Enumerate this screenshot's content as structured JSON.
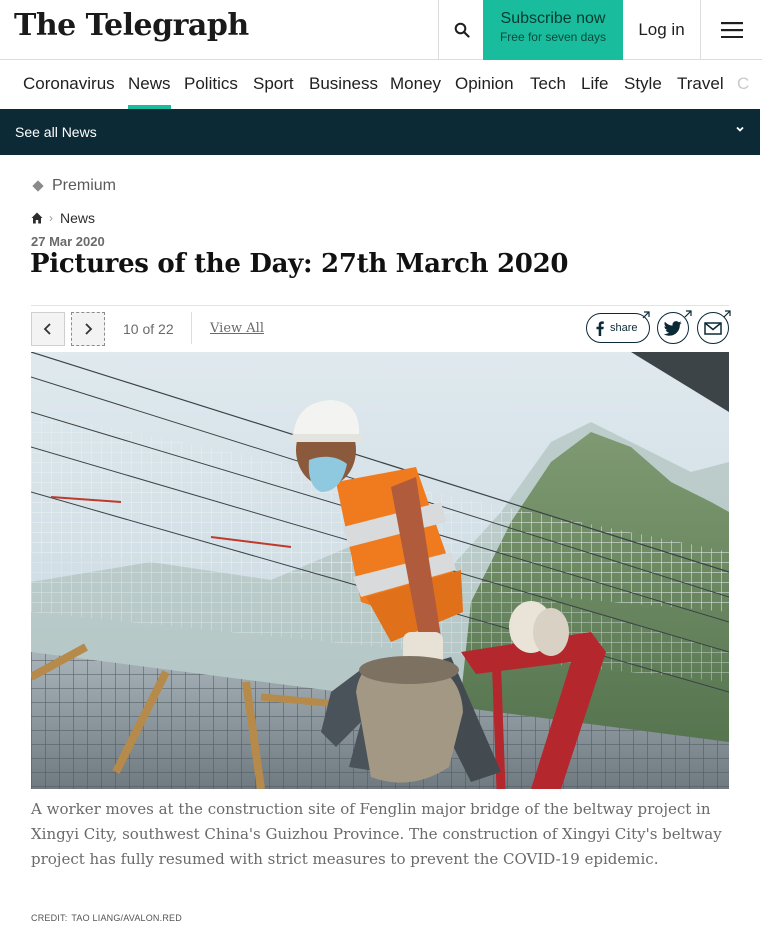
{
  "header": {
    "logo": "The Telegraph",
    "subscribe_title": "Subscribe now",
    "subscribe_sub": "Free for seven days",
    "login": "Log in"
  },
  "nav": {
    "items": [
      "Coronavirus",
      "News",
      "Politics",
      "Sport",
      "Business",
      "Money",
      "Opinion",
      "Tech",
      "Life",
      "Style",
      "Travel",
      "C"
    ],
    "active": "News"
  },
  "see_all": "See all News",
  "article": {
    "badge": "Premium",
    "breadcrumb": "News",
    "date": "27 Mar 2020",
    "title": "Pictures of the Day: 27th March 2020"
  },
  "gallery": {
    "counter": "10 of 22",
    "view_all": "View All",
    "share_label": "share",
    "caption": "A worker moves at the construction site of Fenglin major bridge of the beltway project in Xingyi City, southwest China's Guizhou Province. The construction of Xingyi City's beltway project has fully resumed with strict measures to prevent the COVID-19 epidemic.",
    "credit_label": "CREDIT:",
    "credit_value": "TAO LIANG/AVALON.RED"
  },
  "icons": {
    "search": "search-icon",
    "menu": "hamburger-menu-icon",
    "chevron": "chevron-down-icon",
    "home": "home-icon",
    "prev": "chevron-left-icon",
    "next": "chevron-right-icon",
    "facebook": "facebook-icon",
    "twitter": "twitter-icon",
    "email": "email-icon"
  },
  "colors": {
    "accent": "#19bc9c",
    "navy": "#0b2a36"
  }
}
